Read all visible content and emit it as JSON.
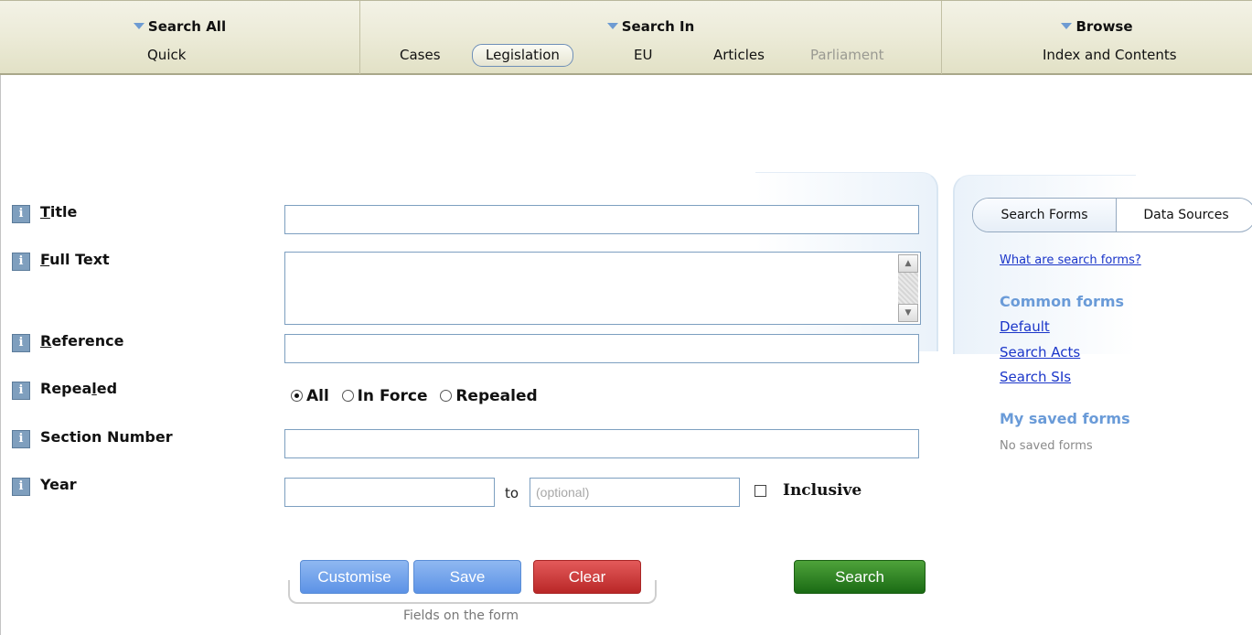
{
  "nav": {
    "search_all": {
      "heading": "Search All",
      "items": [
        "Quick"
      ]
    },
    "search_in": {
      "heading": "Search In",
      "items": [
        "Cases",
        "Legislation",
        "EU",
        "Articles",
        "Parliament"
      ],
      "active": "Legislation",
      "disabled": [
        "Parliament"
      ]
    },
    "browse": {
      "heading": "Browse",
      "items": [
        "Index and Contents"
      ]
    }
  },
  "form": {
    "title_label": {
      "prefix": "",
      "key": "T",
      "rest": "itle"
    },
    "fulltext_label": {
      "prefix": "",
      "key": "F",
      "rest": "ull Text"
    },
    "reference_label": {
      "prefix": "",
      "key": "R",
      "rest": "eference"
    },
    "repealed_label": {
      "prefix": "Repea",
      "key": "l",
      "rest": "ed"
    },
    "section_number_label": "Section Number",
    "year_label": "Year",
    "repealed_options": [
      "All",
      "In Force",
      "Repealed"
    ],
    "repealed_selected": "All",
    "year_to_label": "to",
    "year_to_placeholder": "(optional)",
    "inclusive_label": "Inclusive",
    "inclusive_checked": false,
    "values": {
      "title": "",
      "full_text": "",
      "reference": "",
      "section_number": "",
      "year_from": "",
      "year_to": ""
    }
  },
  "buttons": {
    "customise": "Customise",
    "save": "Save",
    "clear": "Clear",
    "search": "Search",
    "group_caption": "Fields on the form"
  },
  "sidebar": {
    "tabs": [
      "Search Forms",
      "Data Sources"
    ],
    "active_tab": "Search Forms",
    "help_link": "What are search forms?",
    "common_heading": "Common forms",
    "common_forms": [
      "Default",
      "Search Acts",
      "Search SIs"
    ],
    "saved_heading": "My saved forms",
    "saved_note": "No saved forms"
  },
  "colors": {
    "nav_bg": "#ecebd8",
    "link": "#1a35c9",
    "sidebar_heading": "#6a9bd8",
    "save_blue": "#5c92e6",
    "clear_red": "#b92727",
    "search_green": "#1a6b14"
  },
  "icons": {
    "info": "info-icon",
    "nav_arrow": "triangle-down-icon"
  }
}
